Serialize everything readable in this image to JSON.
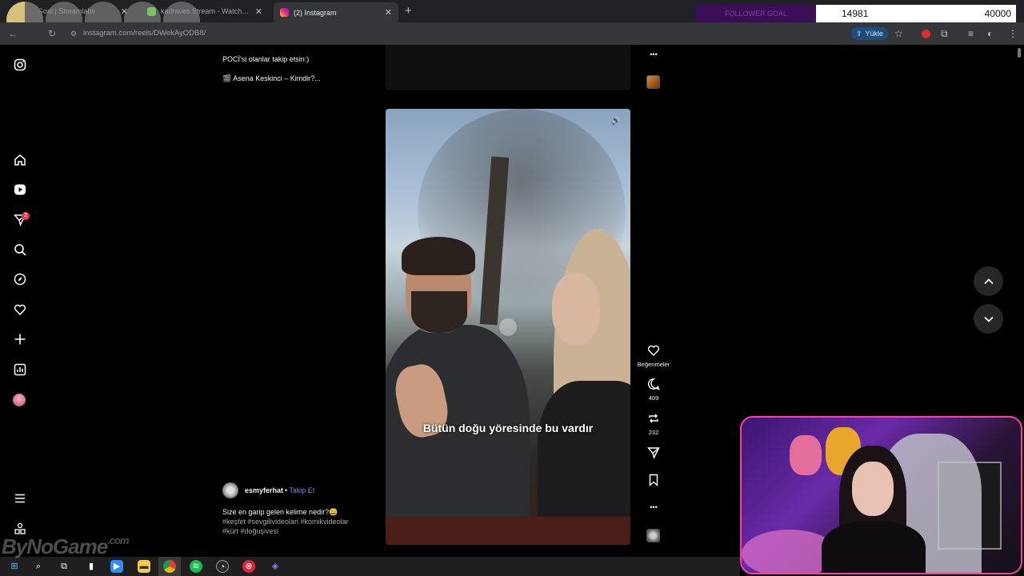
{
  "browser": {
    "tabs": [
      {
        "label": "TV Goal | Streamlabs",
        "favicon_color": "#80f5d2",
        "active": false
      },
      {
        "label": "kadraves Stream - Watch Live c",
        "favicon_color": "#53fc18",
        "active": false
      },
      {
        "label": "(2) Instagram",
        "favicon_color": "#e1306c",
        "active": true
      }
    ],
    "new_tab": "+",
    "url": "instagram.com/reels/DWekAyODB8/",
    "upload_label": "Yükle"
  },
  "goal_widget": {
    "label": "FOLLOWER GOAL",
    "current": "14981",
    "target": "40000"
  },
  "prev_post": {
    "caption_line1": "POCİ'si olanlar takip etsin:)",
    "caption_line2": "🎬 Asena Keskinci – Kimdir?..."
  },
  "sidebar": {
    "notification_count": "2"
  },
  "reel": {
    "subtitle": "Bütün doğu yöresinde bu vardır",
    "author": "esmyferhat",
    "separator": "•",
    "follow_label": "Takip Et",
    "caption": "Size en garip gelen kelime nedir?😄",
    "tags_line1": "#keşfet #sevgilivideolari #komikvideolar",
    "tags_line2": "#kürt #doğuşivesi"
  },
  "actions": {
    "more": "•••",
    "likes_label": "Beğenmeler",
    "comments_count": "409",
    "reposts_count": "232"
  },
  "watermark": {
    "text": "ByNoGame",
    "suffix": ".com"
  },
  "colors": {
    "follow_link": "#6b8cff",
    "badge": "#ff3040",
    "cam_border": "#ff3da6"
  }
}
